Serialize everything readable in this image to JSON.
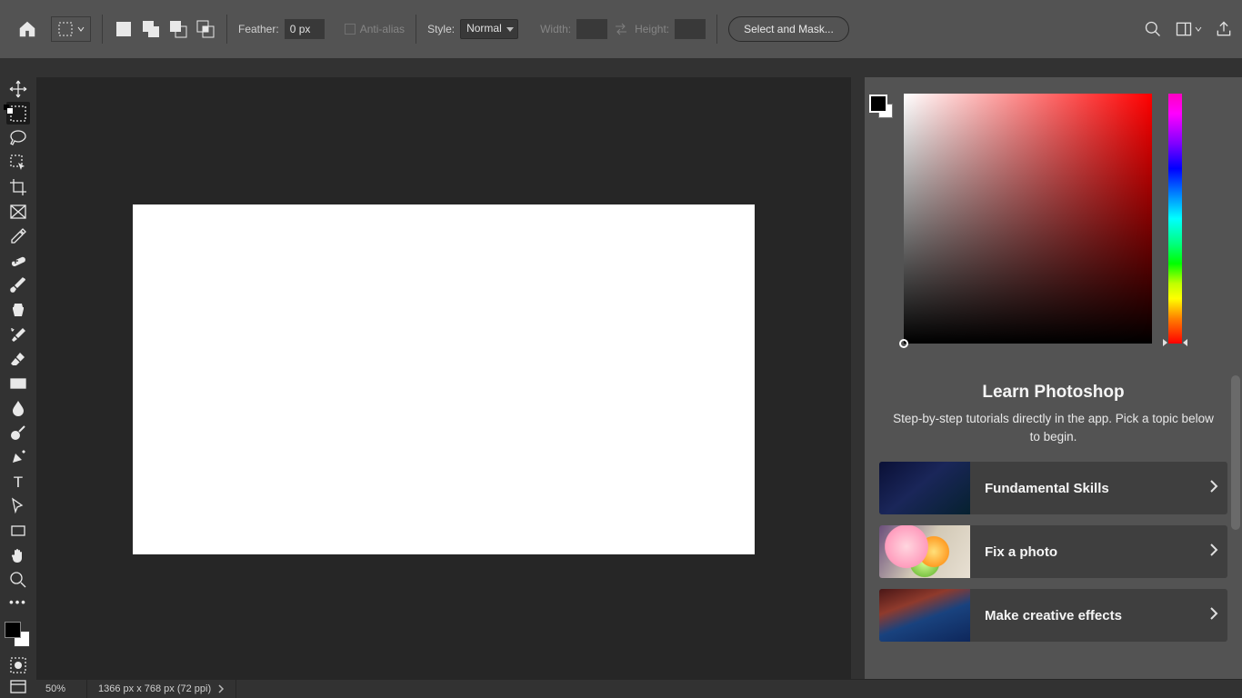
{
  "optionsBar": {
    "featherLabel": "Feather:",
    "featherValue": "0 px",
    "antiAliasLabel": "Anti-alias",
    "styleLabel": "Style:",
    "styleValue": "Normal",
    "widthLabel": "Width:",
    "widthValue": "",
    "heightLabel": "Height:",
    "heightValue": "",
    "selectMaskBtn": "Select and Mask..."
  },
  "canvas": {},
  "learn": {
    "heading": "Learn Photoshop",
    "sub": "Step-by-step tutorials directly in the app. Pick a topic below to begin.",
    "cards": [
      {
        "title": "Fundamental Skills"
      },
      {
        "title": "Fix a photo"
      },
      {
        "title": "Make creative effects"
      }
    ]
  },
  "status": {
    "zoom": "50%",
    "dims": "1366 px x 768 px (72 ppi)"
  }
}
